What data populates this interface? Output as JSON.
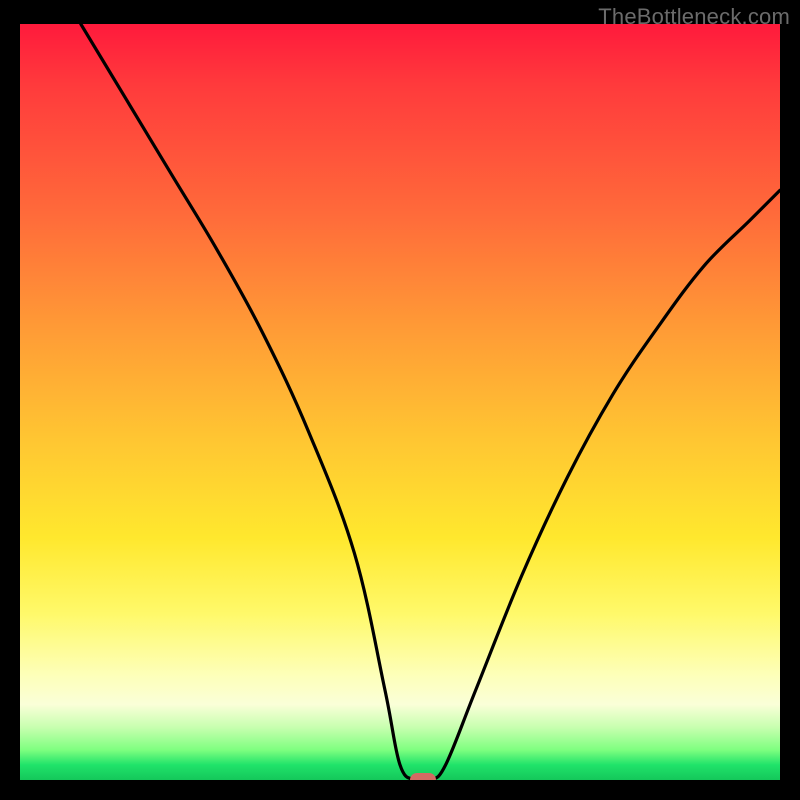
{
  "watermark": "TheBottleneck.com",
  "chart_data": {
    "type": "line",
    "title": "",
    "xlabel": "",
    "ylabel": "",
    "xlim": [
      0,
      100
    ],
    "ylim": [
      0,
      100
    ],
    "x": [
      8,
      14,
      20,
      26,
      32,
      38,
      44,
      48,
      50,
      52,
      54,
      56,
      60,
      66,
      72,
      78,
      84,
      90,
      96,
      100
    ],
    "values": [
      100,
      90,
      80,
      70,
      59,
      46,
      30,
      12,
      2,
      0,
      0,
      2,
      12,
      27,
      40,
      51,
      60,
      68,
      74,
      78
    ],
    "series": [
      {
        "name": "bottleneck-curve",
        "x_key": "x",
        "y_key": "values"
      }
    ],
    "marker": {
      "x": 53,
      "y": 0
    },
    "gradient_stops": [
      {
        "pct": 0,
        "color": "#ff1a3c"
      },
      {
        "pct": 25,
        "color": "#ff6a3a"
      },
      {
        "pct": 55,
        "color": "#ffc632"
      },
      {
        "pct": 78,
        "color": "#fff96a"
      },
      {
        "pct": 92,
        "color": "#c8ffb0"
      },
      {
        "pct": 100,
        "color": "#14c75a"
      }
    ]
  }
}
